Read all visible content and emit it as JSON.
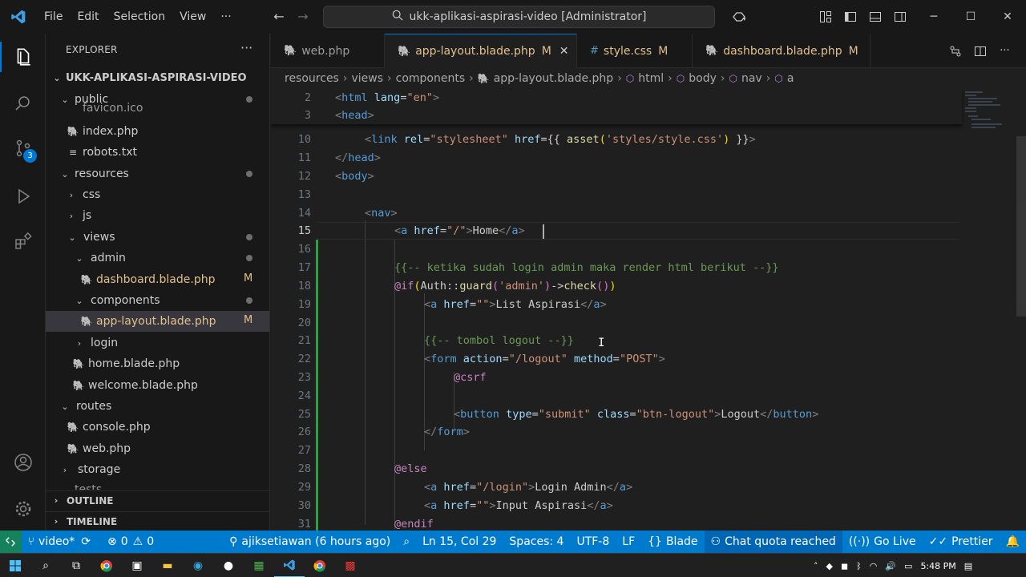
{
  "titlebar": {
    "menu": [
      "File",
      "Edit",
      "Selection",
      "View",
      "···"
    ],
    "search": "ukk-aplikasi-aspirasi-video [Administrator]"
  },
  "activity": {
    "scm_badge": "3"
  },
  "sidebar": {
    "title": "EXPLORER",
    "more": "···",
    "root": "UKK-APLIKASI-ASPIRASI-VIDEO",
    "items": [
      {
        "label": "public"
      },
      {
        "label": "favicon.ico"
      },
      {
        "label": "index.php"
      },
      {
        "label": "robots.txt"
      },
      {
        "label": "resources"
      },
      {
        "label": "css"
      },
      {
        "label": "js"
      },
      {
        "label": "views"
      },
      {
        "label": "admin"
      },
      {
        "label": "dashboard.blade.php",
        "status": "M"
      },
      {
        "label": "components"
      },
      {
        "label": "app-layout.blade.php",
        "status": "M"
      },
      {
        "label": "login"
      },
      {
        "label": "home.blade.php"
      },
      {
        "label": "welcome.blade.php"
      },
      {
        "label": "routes"
      },
      {
        "label": "console.php"
      },
      {
        "label": "web.php"
      },
      {
        "label": "storage"
      },
      {
        "label": "tests"
      }
    ],
    "sections": [
      "OUTLINE",
      "TIMELINE"
    ]
  },
  "tabs": [
    {
      "label": "web.php",
      "icon": "🐘",
      "modified": ""
    },
    {
      "label": "app-layout.blade.php",
      "icon": "🐘",
      "modified": "M"
    },
    {
      "label": "style.css",
      "icon": "#",
      "modified": "M"
    },
    {
      "label": "dashboard.blade.php",
      "icon": "🐘",
      "modified": "M"
    }
  ],
  "breadcrumb": [
    "resources",
    "views",
    "components",
    "app-layout.blade.php",
    "html",
    "body",
    "nav",
    "a"
  ],
  "editor": {
    "line_numbers": [
      "2",
      "3",
      "10",
      "11",
      "12",
      "13",
      "14",
      "15",
      "16",
      "17",
      "18",
      "19",
      "20",
      "21",
      "22",
      "23",
      "24",
      "25",
      "26",
      "27",
      "28",
      "29",
      "30",
      "31"
    ],
    "t": {
      "lt": "<",
      "gt": ">",
      "ltslash": "</",
      "html": "html",
      "lang": "lang",
      "eq": "=",
      "en": "\"en\"",
      "head": "head",
      "link": "link",
      "rel": "rel",
      "stylesheet": "\"stylesheet\"",
      "href": "href",
      "eqb": "={{ ",
      "asset": "asset",
      "po": "(",
      "pc": ")",
      "stylecss": "'styles/style.css'",
      "closeb": " }}",
      "body": "body",
      "nav": "nav",
      "a": "a",
      "slash": "\"/\"",
      "home": "Home",
      "c17": "{{-- ketika sudah login admin maka render html berikut --}}",
      "if": "@if",
      "auth": "Auth::",
      "guard": "guard",
      "admin": "'admin'",
      "arrow": "->",
      "check": "check",
      "empty": "\"\"",
      "listasp": "List Aspirasi",
      "c21": "{{-- tombol logout --}}",
      "form": "form",
      "action": "action",
      "logout": "\"/logout\"",
      "method": "method",
      "post": "\"POST\"",
      "csrf": "@csrf",
      "button": "button",
      "type": "type",
      "submit": "\"submit\"",
      "class": "class",
      "btnlogout": "\"btn-logout\"",
      "logoutTxt": "Logout",
      "else": "@else",
      "login": "\"/login\"",
      "loginAdmin": "Login Admin",
      "inputAsp": "Input Aspirasi",
      "endif": "@endif"
    }
  },
  "statusbar": {
    "branch": "video*",
    "errors": "0",
    "warnings": "0",
    "blame": "ajiksetiawan (6 hours ago)",
    "position": "Ln 15, Col 29",
    "spaces": "Spaces: 4",
    "encoding": "UTF-8",
    "eol": "LF",
    "language": "Blade",
    "copilot": "Chat quota reached",
    "golive": "Go Live",
    "prettier": "Prettier"
  },
  "taskbar": {
    "time": "5:48 PM"
  },
  "colors": {
    "accent": "#0078d4",
    "statusbar": "#007acc",
    "modified": "#e2c08d"
  }
}
